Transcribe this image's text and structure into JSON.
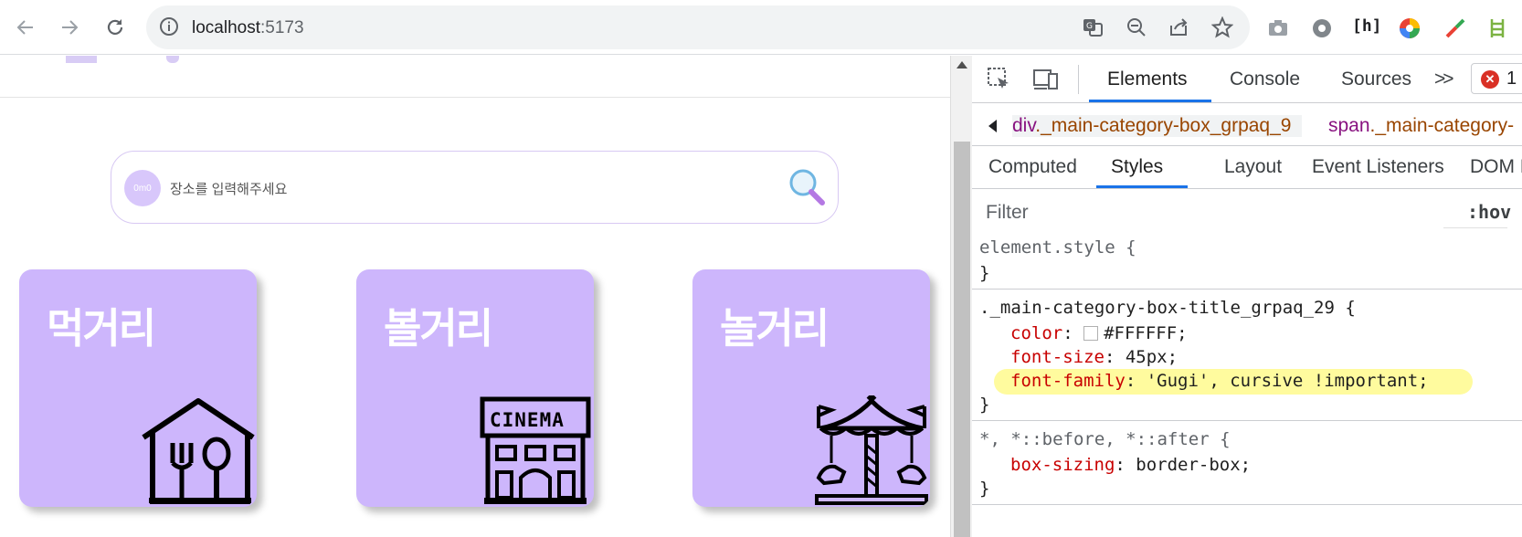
{
  "browser": {
    "url_host": "localhost",
    "url_port": ":5173"
  },
  "page": {
    "search": {
      "avatar_text": "0m0",
      "placeholder": "장소를 입력해주세요"
    },
    "cards": [
      {
        "title": "먹거리",
        "icon": "restaurant-house-icon"
      },
      {
        "title": "볼거리",
        "icon": "cinema-icon"
      },
      {
        "title": "놀거리",
        "icon": "carousel-icon"
      }
    ]
  },
  "devtools": {
    "tabs": [
      "Elements",
      "Console",
      "Sources"
    ],
    "more": ">>",
    "error_count": "1",
    "breadcrumbs": {
      "first_tag": "div",
      "first_class": "._main-category-box_grpaq_9",
      "second_tag": "span",
      "second_class": "._main-category-"
    },
    "subtabs": [
      "Computed",
      "Styles",
      "Layout",
      "Event Listeners",
      "DOM B"
    ],
    "filter_placeholder": "Filter",
    "hov": ":hov",
    "rules": {
      "r1_selector": "element.style {",
      "r1_close": "}",
      "r2_selector": "._main-category-box-title_grpaq_29 {",
      "r2_color_prop": "color",
      "r2_color_val": "#FFFFFF;",
      "r2_size_prop": "font-size",
      "r2_size_val": "45px;",
      "r2_family_prop": "font-family",
      "r2_family_val": "'Gugi', cursive !important;",
      "r2_close": "}",
      "r3_selector": "*, *::before, *::after {",
      "r3_prop": "box-sizing",
      "r3_val": "border-box;",
      "r3_close": "}"
    }
  }
}
